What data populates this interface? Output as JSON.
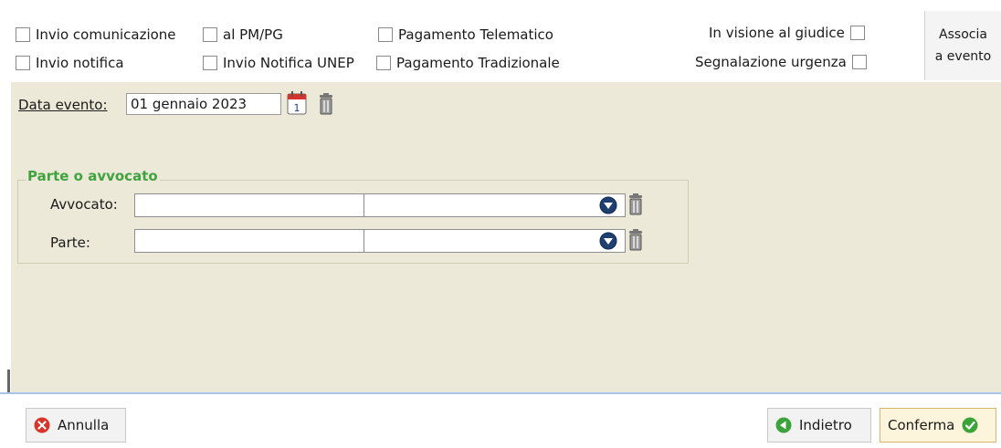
{
  "top_checkboxes": {
    "invio_comunicazione": "Invio comunicazione",
    "al_pm_pg": "al PM/PG",
    "pagamento_telematico": "Pagamento Telematico",
    "in_visione_giudice": "In visione al giudice",
    "invio_notifica": "Invio notifica",
    "invio_notifica_unep": "Invio Notifica UNEP",
    "pagamento_tradizionale": "Pagamento Tradizionale",
    "segnalazione_urgenza": "Segnalazione urgenza"
  },
  "associa_button": {
    "line1": "Associa",
    "line2": "a evento"
  },
  "data_evento": {
    "label": "Data evento:",
    "value": "01 gennaio 2023",
    "calendar_day": "1"
  },
  "parte_group": {
    "legend": "Parte o avvocato",
    "avvocato_label": "Avvocato:",
    "parte_label": "Parte:"
  },
  "footer": {
    "annulla": "Annulla",
    "indietro": "Indietro",
    "conferma": "Conferma"
  },
  "colors": {
    "panel": "#ece9d8",
    "legend_green": "#3fa33f",
    "danger_red": "#d9342b",
    "ok_green": "#3aa33a"
  }
}
